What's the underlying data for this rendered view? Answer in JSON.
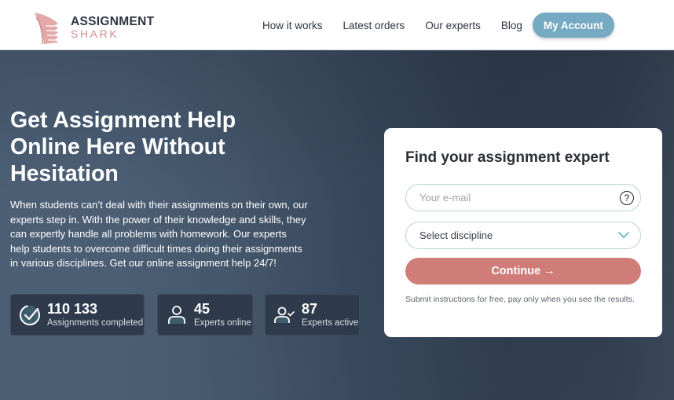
{
  "brand": {
    "name_main": "ASSIGNMENT",
    "name_sub": "SHARK",
    "logo_icon": "shark-fin-icon",
    "accent": "#d58f8f"
  },
  "nav": {
    "links": [
      {
        "label": "How it works"
      },
      {
        "label": "Latest orders"
      },
      {
        "label": "Our experts"
      },
      {
        "label": "Blog"
      }
    ],
    "account_button": "My Account",
    "account_color": "#76a9c2"
  },
  "hero": {
    "headline": "Get Assignment Help Online Here Without Hesitation",
    "intro": "When students can’t deal with their assignments on their own, our experts step in. With the power of their knowledge and skills, they can expertly handle all problems with homework. Our experts help students to overcome difficult times doing their assignments in various disciplines. Get our online assignment help 24/7!",
    "stats": [
      {
        "icon": "check-circle-icon",
        "value": "110 133",
        "label": "Assignments completed"
      },
      {
        "icon": "user-icon",
        "value": "45",
        "label": "Experts online"
      },
      {
        "icon": "user-check-icon",
        "value": "87",
        "label": "Experts active"
      }
    ]
  },
  "form": {
    "title": "Find your assignment expert",
    "email_placeholder": "Your e-mail",
    "email_value": "",
    "help_glyph": "?",
    "discipline_selected": "Select discipline",
    "continue_label": "Continue →",
    "continue_color": "#d07d7a",
    "note": "Submit instructions for free, pay only when you see the results."
  }
}
